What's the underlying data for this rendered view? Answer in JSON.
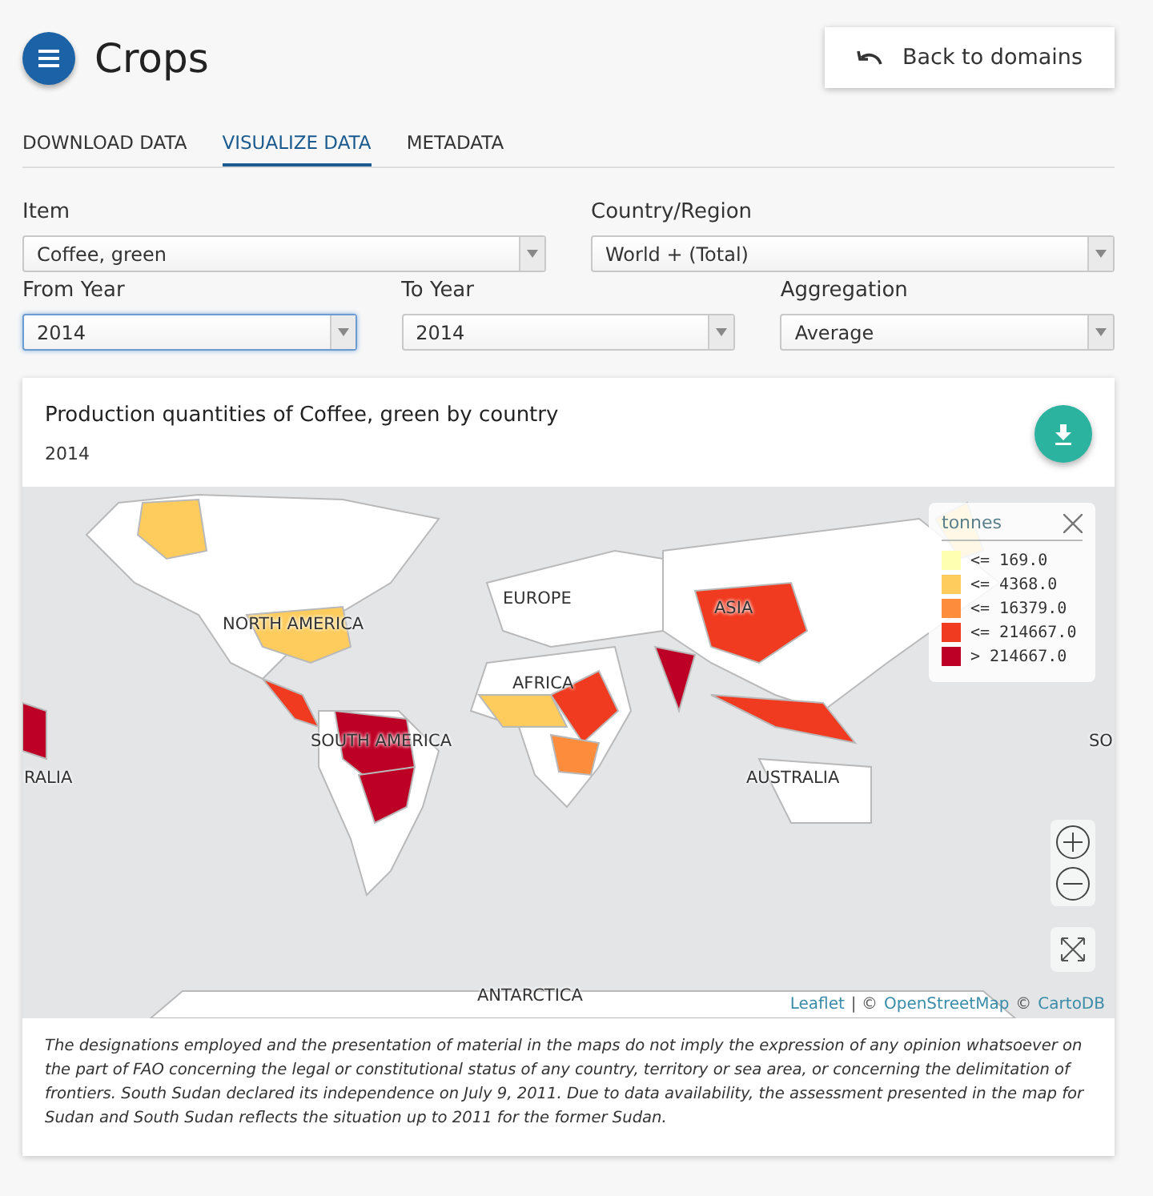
{
  "header": {
    "title": "Crops",
    "back_button": "Back to domains"
  },
  "tabs": [
    {
      "label": "DOWNLOAD DATA",
      "selected": false
    },
    {
      "label": "VISUALIZE DATA",
      "selected": true
    },
    {
      "label": "METADATA",
      "selected": false
    }
  ],
  "filter_rows": [
    {
      "fields": [
        {
          "label": "Item",
          "value": "Coffee, green",
          "focused": false
        },
        {
          "label": "Country/Region",
          "value": "World + (Total)",
          "focused": false
        }
      ]
    },
    {
      "fields": [
        {
          "label": "From Year",
          "value": "2014",
          "focused": true
        },
        {
          "label": "To Year",
          "value": "2014",
          "focused": false
        },
        {
          "label": "Aggregation",
          "value": "Average",
          "focused": false
        }
      ]
    }
  ],
  "chart_card": {
    "title": "Production quantities of Coffee, green by country",
    "subtitle": "2014",
    "map_labels": [
      "EUROPE",
      "ASIA",
      "NORTH AMERICA",
      "AFRICA",
      "SOUTH AMERICA",
      "SO",
      "RALIA",
      "AUSTRALIA",
      "ANTARCTICA"
    ],
    "legend": {
      "title": "tonnes",
      "items": [
        {
          "label": "<= 169.0",
          "color": "#ffffb2"
        },
        {
          "label": "<= 4368.0",
          "color": "#fecc5c"
        },
        {
          "label": "<= 16379.0",
          "color": "#fd8d3c"
        },
        {
          "label": "<= 214667.0",
          "color": "#f03b20"
        },
        {
          "label": "> 214667.0",
          "color": "#bd0026"
        }
      ]
    },
    "attribution": [
      {
        "kind": "link",
        "text": "Leaflet"
      },
      {
        "kind": "text",
        "text": "| ©"
      },
      {
        "kind": "link",
        "text": "OpenStreetMap"
      },
      {
        "kind": "text",
        "text": "©"
      },
      {
        "kind": "link",
        "text": "CartoDB"
      }
    ],
    "disclaimer": "The designations employed and the presentation of material in the maps do not imply the expression of any opinion whatsoever on the part of FAO concerning the legal or constitutional status of any country, territory or sea area, or concerning the delimitation of frontiers. South Sudan declared its independence on July 9, 2011. Due to data availability, the assessment presented in the map for Sudan and South Sudan reflects the situation up to 2011 for the former Sudan."
  }
}
